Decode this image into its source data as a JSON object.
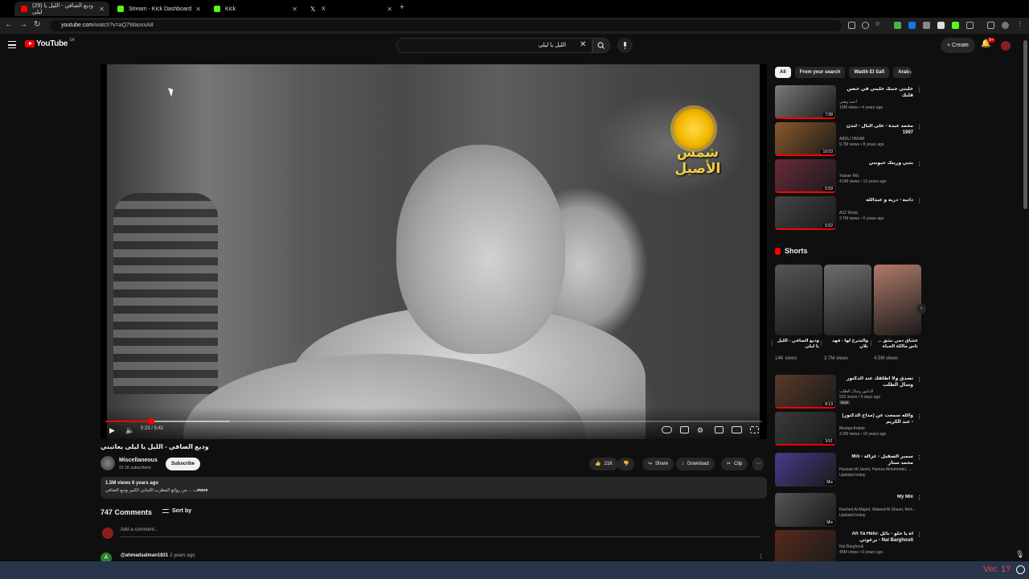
{
  "browser": {
    "tabs": [
      {
        "title": "(29) وديع الصافي - الليل يا ليلى",
        "color": "#ff0000",
        "active": true
      },
      {
        "title": "Stream - Kick Dashboard",
        "color": "#53fc18",
        "active": false
      },
      {
        "title": "Kick",
        "color": "#53fc18",
        "active": false
      },
      {
        "title": "X",
        "color": "#ffffff",
        "active": false
      }
    ],
    "new_tab": "+",
    "url_host": "youtube.com",
    "url_path": "/watch?v=aQ7WaoxxA8"
  },
  "header": {
    "logo_text": "YouTube",
    "logo_region": "SA",
    "search_query": "الليل يا ليلى",
    "create_label": "Create",
    "notification_count": "9+"
  },
  "player": {
    "channel_watermark": "شمس الأصيل",
    "time_display": "0:23 / 5:41",
    "progress_played": 0.07,
    "progress_buffered": 0.19
  },
  "video": {
    "title": "وديع الصافي - الليل يا ليلى يعاتبني",
    "channel_name": "Miscellaneous",
    "subscribers": "22.1K subscribers",
    "subscribe_label": "Subscribe",
    "likes": "21K",
    "share_label": "Share",
    "download_label": "Download",
    "clip_label": "Clip",
    "more_label": "⋯",
    "stats": "1.5M views  6 years ago",
    "description": "من روائع المطرب اللبناني الكبير وديع الصافي ...",
    "more_link": "...more"
  },
  "comments": {
    "count_label": "747 Comments",
    "sort_label": "Sort by",
    "add_placeholder": "Add a comment...",
    "first_author": "@ahmadsalman1831",
    "first_time": "2 years ago",
    "first_initial": "A"
  },
  "sidebar": {
    "chips": [
      "All",
      "From your search",
      "Wadih El Safi",
      "Arab"
    ],
    "recs_top": [
      {
        "title": "خليني جنبك خليني في حضن قلبك",
        "channel": "أحمد وهبي",
        "meta": "10M views • 4 years ago",
        "duration": "7:08",
        "color": "#7a7a7a"
      },
      {
        "title": "محمد عبده - على البال - لندن 1997",
        "channel": "ABDU TARAB",
        "meta": "9.7M views • 8 years ago",
        "duration": "10:03",
        "color": "#8a5a2a"
      },
      {
        "title": "بتبي وريتك حبوبتي",
        "channel": "Yasser MU",
        "meta": "4.5M views • 13 years ago",
        "duration": "5:59",
        "color": "#6a2a3a"
      },
      {
        "title": "دانيه - درية و عبدالله",
        "channel": "A2Z Music",
        "meta": "3.7M views • 6 years ago",
        "duration": "5:02",
        "color": "#444444"
      }
    ],
    "shorts_heading": "Shorts",
    "shorts": [
      {
        "title": "وديع الصافي - الليل يا ليلى",
        "views": "14K views",
        "color": "#555555"
      },
      {
        "title": "والشرح لها - فهد بلان",
        "views": "3.7M views",
        "color": "#6e6e6e"
      },
      {
        "title": "عشاق دمي نشق ... ناس مالكة الحياة",
        "views": "4.5M views",
        "color": "#b07a6a"
      }
    ],
    "recs_bottom": [
      {
        "title": "تصدق ولا أطلقك عند الدكتور وسال الطلب",
        "channel": "الدكتور وسال الطلب",
        "meta": "532 views • 5 days ago",
        "badge": "New",
        "duration": "8:13",
        "color": "#5a3a2a"
      },
      {
        "title": "والله سمعت عن (مداح الدكتور) - عبد الكريم",
        "channel": "Musiqa Arabia",
        "meta": "3.2M views • 10 years ago",
        "duration": "3:51",
        "color": "#3a3a3a"
      },
      {
        "title": "Mix - سمير الصقيل - عزالة محمد ستار",
        "channel": "Hussain Al Jasmi, Hamza Almahmdei, ...",
        "meta": "Updated today",
        "duration": "Mix",
        "color": "#4a3a8a"
      },
      {
        "title": "My Mix",
        "channel": "Rashed Al-Majed, Waleed Al Shami, Moh...",
        "meta": "Updated today",
        "duration": "Mix",
        "color": "#555555"
      },
      {
        "title": "Ah Ya Helu- آه يا حلو - نائل برغوثي - Nai Barghouti",
        "channel": "Nai Barghouti",
        "meta": "45M views • 6 years ago",
        "duration": "",
        "color": "#5a2a1a"
      }
    ]
  },
  "overlay": {
    "version_text": "Ver. 1?"
  },
  "colors": {
    "accent_red": "#ff0000",
    "background": "#0f0f0f",
    "bottom_bar": "#29354a"
  }
}
